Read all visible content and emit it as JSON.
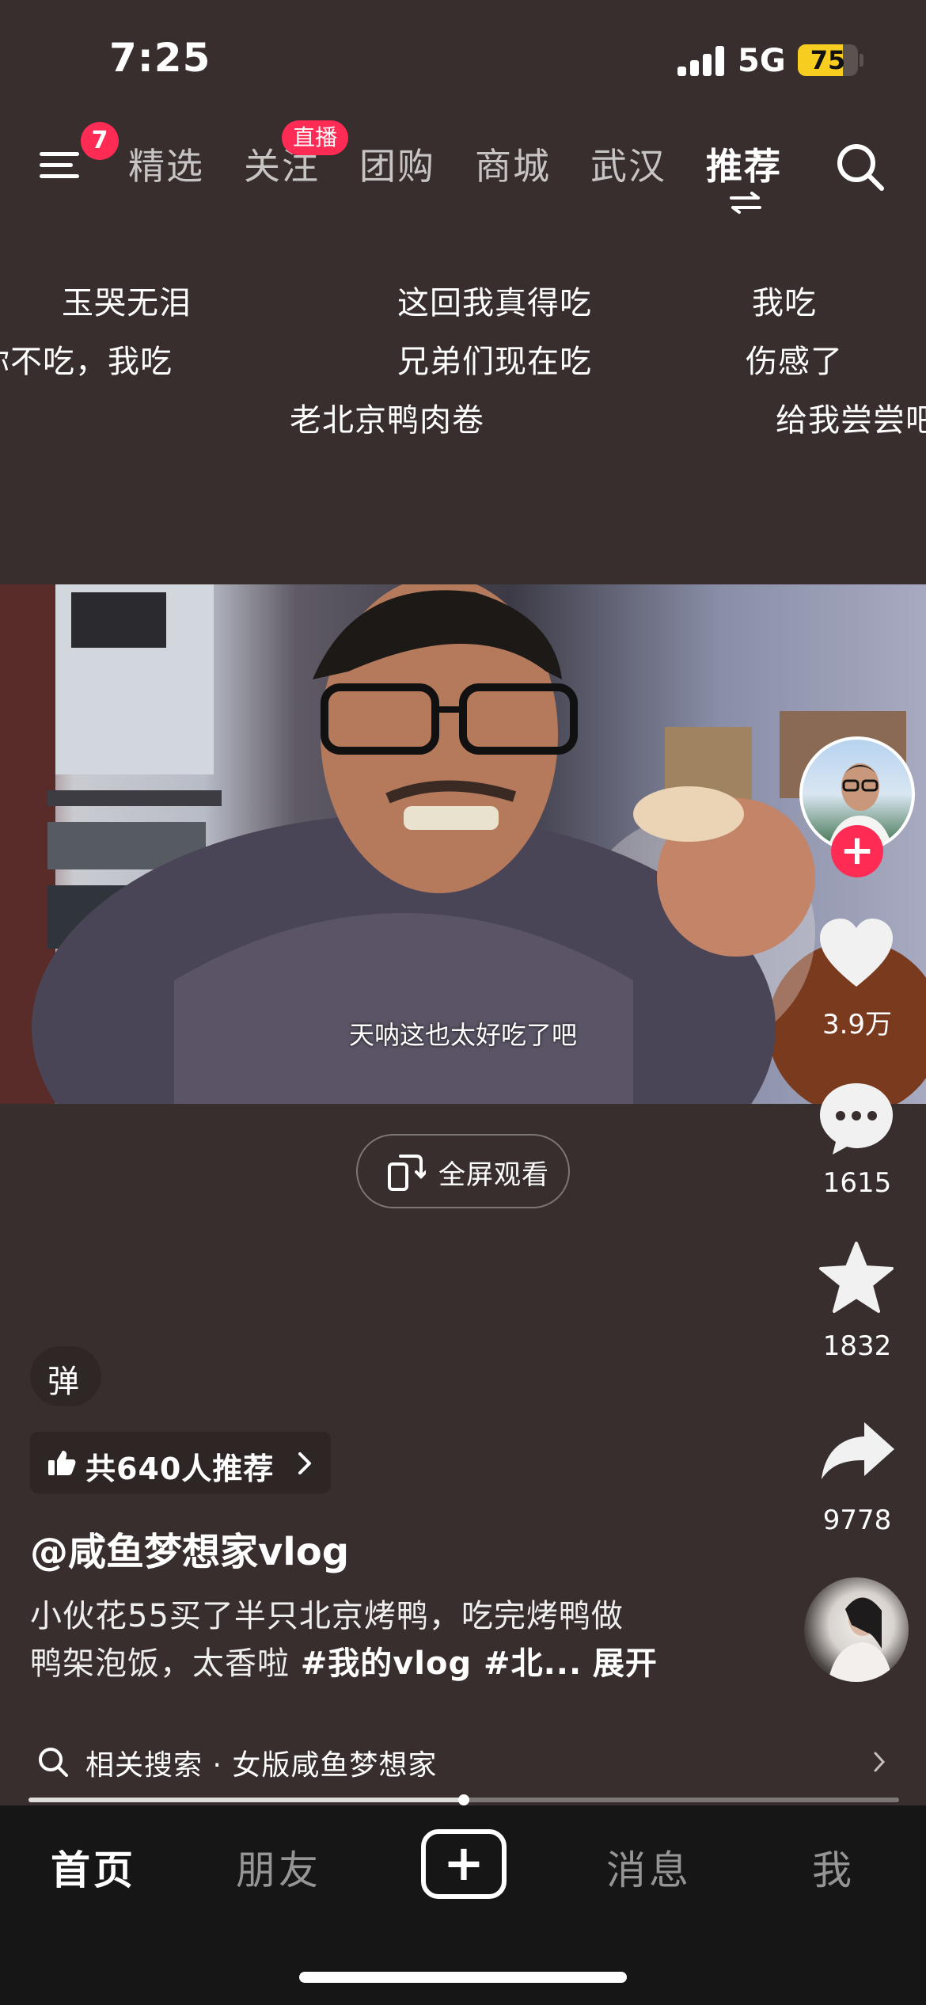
{
  "status_bar": {
    "time": "7:25",
    "network": "5G",
    "battery": "75",
    "battery_level": 0.75
  },
  "top_nav": {
    "menu_badge": "7",
    "live_badge": "直播",
    "tabs": [
      {
        "label": "精选"
      },
      {
        "label": "关注"
      },
      {
        "label": "团购"
      },
      {
        "label": "商城"
      },
      {
        "label": "武汉"
      },
      {
        "label": "推荐",
        "active": true
      }
    ]
  },
  "danmaku": [
    {
      "text": "玉哭无泪"
    },
    {
      "text": "这回我真得吃"
    },
    {
      "text": "我吃"
    },
    {
      "text": "你不吃，我吃"
    },
    {
      "text": "兄弟们现在吃"
    },
    {
      "text": "伤感了"
    },
    {
      "text": "老北京鸭肉卷"
    },
    {
      "text": "给我尝尝吧"
    }
  ],
  "video": {
    "subtitle": "天呐这也太好吃了吧",
    "fullscreen_label": "全屏观看"
  },
  "actions": {
    "likes": "3.9万",
    "comments": "1615",
    "favorites": "1832",
    "shares": "9778"
  },
  "info": {
    "danmu_toggle": "弹",
    "recommend": "共640人推荐",
    "author": "@咸鱼梦想家vlog",
    "caption_line1": "小伙花55买了半只北京烤鸭，吃完烤鸭做",
    "caption_line2_text": "鸭架泡饭，太香啦 ",
    "caption_line2_tags": "#我的vlog #北...",
    "expand": "展开",
    "related_search": "相关搜索 · 女版咸鱼梦想家",
    "progress": 0.5
  },
  "tab_bar": {
    "home": "首页",
    "friends": "朋友",
    "create": "+",
    "messages": "消息",
    "me": "我"
  },
  "colors": {
    "accent": "#fe2c55",
    "background": "#372e2d",
    "tabbar": "#161616",
    "battery": "#f7ce1f"
  }
}
